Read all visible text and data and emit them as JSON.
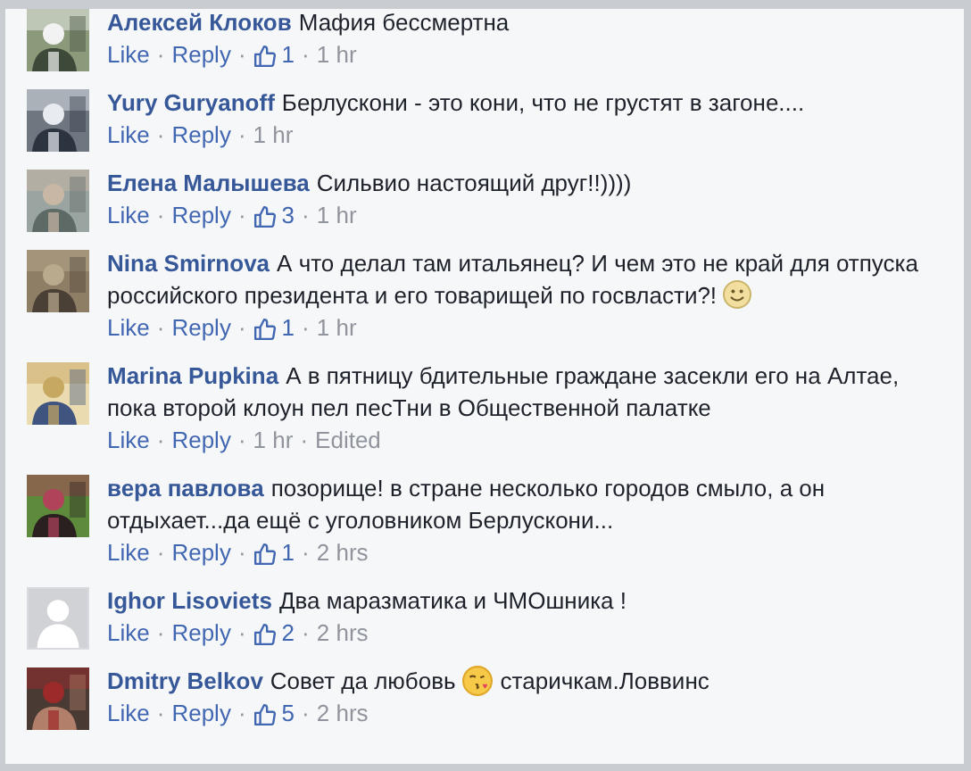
{
  "comments": [
    {
      "author": "Алексей Клоков",
      "default_avatar": false,
      "body": [
        {
          "kind": "text",
          "text": "Мафия бессмертна"
        }
      ],
      "meta": [
        {
          "kind": "link",
          "text": "Like"
        },
        {
          "kind": "dot",
          "text": "·"
        },
        {
          "kind": "link",
          "text": "Reply"
        },
        {
          "kind": "dot",
          "text": "·"
        },
        {
          "kind": "likes",
          "text": "1"
        },
        {
          "kind": "dot",
          "text": "·"
        },
        {
          "kind": "time",
          "text": "1 hr"
        }
      ]
    },
    {
      "author": "Yury Guryanoff",
      "default_avatar": false,
      "body": [
        {
          "kind": "text",
          "text": "Берлускони - это кони, что не грустят в загоне...."
        }
      ],
      "meta": [
        {
          "kind": "link",
          "text": "Like"
        },
        {
          "kind": "dot",
          "text": "·"
        },
        {
          "kind": "link",
          "text": "Reply"
        },
        {
          "kind": "dot",
          "text": "·"
        },
        {
          "kind": "time",
          "text": "1 hr"
        }
      ]
    },
    {
      "author": "Елена Малышева",
      "default_avatar": false,
      "body": [
        {
          "kind": "text",
          "text": "Сильвио настоящий друг!!))))"
        }
      ],
      "meta": [
        {
          "kind": "link",
          "text": "Like"
        },
        {
          "kind": "dot",
          "text": "·"
        },
        {
          "kind": "link",
          "text": "Reply"
        },
        {
          "kind": "dot",
          "text": "·"
        },
        {
          "kind": "likes",
          "text": "3"
        },
        {
          "kind": "dot",
          "text": "·"
        },
        {
          "kind": "time",
          "text": "1 hr"
        }
      ]
    },
    {
      "author": "Nina Smirnova",
      "default_avatar": false,
      "body": [
        {
          "kind": "text",
          "text": "А что делал там итальянец? И чем это не край для отпуска российского президента и его товарищей по госвласти?!"
        },
        {
          "kind": "smile"
        }
      ],
      "meta": [
        {
          "kind": "link",
          "text": "Like"
        },
        {
          "kind": "dot",
          "text": "·"
        },
        {
          "kind": "link",
          "text": "Reply"
        },
        {
          "kind": "dot",
          "text": "·"
        },
        {
          "kind": "likes",
          "text": "1"
        },
        {
          "kind": "dot",
          "text": "·"
        },
        {
          "kind": "time",
          "text": "1 hr"
        }
      ]
    },
    {
      "author": "Marina Pupkina",
      "default_avatar": false,
      "body": [
        {
          "kind": "text",
          "text": "А в пятницу бдительные граждане засекли его на Алтае, пока второй клоун пел песТни в Общественной палатке"
        }
      ],
      "meta": [
        {
          "kind": "link",
          "text": "Like"
        },
        {
          "kind": "dot",
          "text": "·"
        },
        {
          "kind": "link",
          "text": "Reply"
        },
        {
          "kind": "dot",
          "text": "·"
        },
        {
          "kind": "time",
          "text": "1 hr"
        },
        {
          "kind": "dot",
          "text": "·"
        },
        {
          "kind": "time",
          "text": "Edited"
        }
      ]
    },
    {
      "author": "вера павлова",
      "default_avatar": false,
      "body": [
        {
          "kind": "text",
          "text": "позорище! в стране несколько городов смыло, а он отдыхает...да ещё с уголовником Берлускони..."
        }
      ],
      "meta": [
        {
          "kind": "link",
          "text": "Like"
        },
        {
          "kind": "dot",
          "text": "·"
        },
        {
          "kind": "link",
          "text": "Reply"
        },
        {
          "kind": "dot",
          "text": "·"
        },
        {
          "kind": "likes",
          "text": "1"
        },
        {
          "kind": "dot",
          "text": "·"
        },
        {
          "kind": "time",
          "text": "2 hrs"
        }
      ]
    },
    {
      "author": "Ighor Lisoviets",
      "default_avatar": true,
      "body": [
        {
          "kind": "text",
          "text": "Два маразматика и ЧМОшника !"
        }
      ],
      "meta": [
        {
          "kind": "link",
          "text": "Like"
        },
        {
          "kind": "dot",
          "text": "·"
        },
        {
          "kind": "link",
          "text": "Reply"
        },
        {
          "kind": "dot",
          "text": "·"
        },
        {
          "kind": "likes",
          "text": "2"
        },
        {
          "kind": "dot",
          "text": "·"
        },
        {
          "kind": "time",
          "text": "2 hrs"
        }
      ]
    },
    {
      "author": "Dmitry Belkov",
      "default_avatar": false,
      "body": [
        {
          "kind": "text",
          "text": "Совет да любовь"
        },
        {
          "kind": "kiss"
        },
        {
          "kind": "text",
          "text": "старичкам.Ловвинс"
        }
      ],
      "meta": [
        {
          "kind": "link",
          "text": "Like"
        },
        {
          "kind": "dot",
          "text": "·"
        },
        {
          "kind": "link",
          "text": "Reply"
        },
        {
          "kind": "dot",
          "text": "·"
        },
        {
          "kind": "likes",
          "text": "5"
        },
        {
          "kind": "dot",
          "text": "·"
        },
        {
          "kind": "time",
          "text": "2 hrs"
        }
      ]
    }
  ]
}
